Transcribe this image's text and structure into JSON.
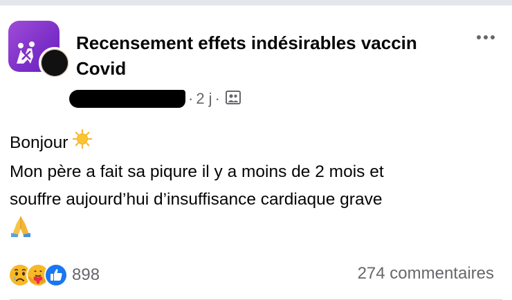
{
  "post": {
    "group_name": "Recensement effets indésirables vaccin Covid",
    "author_name": "",
    "time_ago": "2 j",
    "separator": "·",
    "audience_icon": "group-members-icon",
    "more_icon": "more-options-icon"
  },
  "body": {
    "lines": [
      "Bonjour",
      "Mon père a fait sa piqure il y a moins de 2 mois et",
      "souffre aujourd’hui d’insuffisance cardiaque grave"
    ],
    "emojis": [
      "sun-emoji",
      "folded-hands-emoji"
    ]
  },
  "footer": {
    "reaction_icons": [
      "sad-reaction-icon",
      "care-reaction-icon",
      "like-reaction-icon"
    ],
    "reaction_count": "898",
    "comments": "274 commentaires"
  },
  "colors": {
    "group_avatar": "#7b2fc8",
    "secondary_text": "#65676b",
    "like_blue": "#1877f2",
    "reaction_yellow": "#f7b928"
  }
}
